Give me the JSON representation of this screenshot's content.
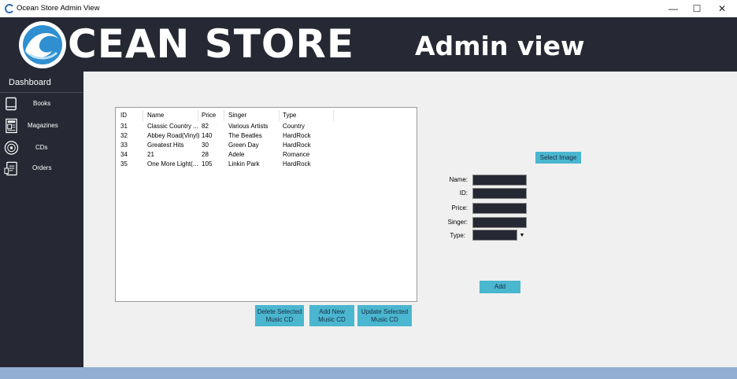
{
  "window": {
    "title": "Ocean Store Admin View",
    "minimize_glyph": "—",
    "maximize_glyph": "☐",
    "close_glyph": "✕"
  },
  "banner": {
    "brand": "CEAN STORE",
    "subtitle": "Admin view",
    "logo_icon": "wave-logo-icon"
  },
  "sidebar": {
    "dashboard_label": "Dashboard",
    "items": [
      {
        "label": "Books",
        "icon": "book-icon"
      },
      {
        "label": "Magazines",
        "icon": "magazine-icon"
      },
      {
        "label": "CDs",
        "icon": "cd-icon"
      },
      {
        "label": "Orders",
        "icon": "orders-icon"
      }
    ]
  },
  "table": {
    "columns": [
      "ID",
      "Name",
      "Price",
      "Singer",
      "Type"
    ],
    "rows": [
      [
        "31",
        "Classic Country ...",
        "82",
        "Various Artists",
        "Country"
      ],
      [
        "32",
        "Abbey Road(Vinyl)",
        "140",
        "The Beatles",
        "HardRock"
      ],
      [
        "33",
        "Greatest Hits",
        "30",
        "Green Day",
        "HardRock"
      ],
      [
        "34",
        "21",
        "28",
        "Adele",
        "Romance"
      ],
      [
        "35",
        "One More Light(...",
        "105",
        "Linkin Park",
        "HardRock"
      ]
    ]
  },
  "buttons": {
    "delete_line1": "Delete Selected",
    "delete_line2": "Music CD",
    "addnew_line1": "Add New",
    "addnew_line2": "Music CD",
    "update_line1": "Update Selected",
    "update_line2": "Music CD",
    "select_image": "Select Image",
    "add": "Add"
  },
  "form": {
    "name_label": "Name:",
    "id_label": "ID:",
    "price_label": "Price:",
    "singer_label": "Singer:",
    "type_label": "Type:",
    "name_value": "",
    "id_value": "",
    "price_value": "",
    "singer_value": "",
    "type_value": ""
  },
  "colors": {
    "dark": "#262833",
    "accent": "#4ab6cf",
    "panel": "#f0f0f0",
    "status_bar": "#92aed0"
  }
}
